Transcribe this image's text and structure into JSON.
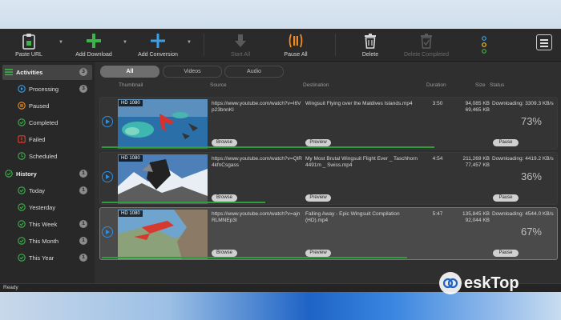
{
  "toolbar": {
    "paste_url": "Paste URL",
    "add_download": "Add Download",
    "add_conversion": "Add Conversion",
    "start_all": "Start All",
    "pause_all": "Pause All",
    "delete": "Delete",
    "delete_completed": "Delete Completed",
    "colors": {
      "green": "#3cb44b",
      "blue": "#3aa0e8",
      "orange": "#f08a24"
    }
  },
  "sidebar": {
    "activities": {
      "label": "Activities",
      "count": "3"
    },
    "processing": {
      "label": "Processing",
      "count": "3"
    },
    "paused": {
      "label": "Paused"
    },
    "completed": {
      "label": "Completed"
    },
    "failed": {
      "label": "Failed"
    },
    "scheduled": {
      "label": "Scheduled"
    },
    "history": {
      "label": "History",
      "count": "1"
    },
    "today": {
      "label": "Today",
      "count": "1"
    },
    "yesterday": {
      "label": "Yesterday"
    },
    "this_week": {
      "label": "This Week",
      "count": "1"
    },
    "this_month": {
      "label": "This Month",
      "count": "1"
    },
    "this_year": {
      "label": "This Year",
      "count": "1"
    }
  },
  "filter_tabs": {
    "all": "All",
    "videos": "Videos",
    "audio": "Audio"
  },
  "columns": {
    "thumbnail": "Thumbnail",
    "source": "Source",
    "destination": "Destination",
    "duration": "Duration",
    "size": "Size",
    "status": "Status"
  },
  "downloads": [
    {
      "badge": "HD 1080",
      "url": "https://www.youtube.com/watch?v=I6Vp23bnnKI",
      "destination": "Wingsuit Flying over the Maldives Islands.mp4",
      "duration": "3:50",
      "size_total": "94,085 KB",
      "size_done": "69,465 KB",
      "status": "Downloading: 3309.3 KB/s",
      "percent": "73%",
      "progress": 0.73,
      "browse": "Browse",
      "preview": "Preview",
      "pause": "Pause"
    },
    {
      "badge": "HD 1080",
      "url": "https://www.youtube.com/watch?v=QlR4kfnCsgass",
      "destination": "My Most Brutal Wingsuit Flight Ever _ Taschhorn 4491m _ Swiss.mp4",
      "duration": "4:54",
      "size_total": "211,269 KB",
      "size_done": "77,457 KB",
      "status": "Downloading: 4419.2 KB/s",
      "percent": "36%",
      "progress": 0.36,
      "browse": "Browse",
      "preview": "Preview",
      "pause": "Pause"
    },
    {
      "badge": "HD 1080",
      "url": "https://www.youtube.com/watch?v=ajnRLMNEp3I",
      "destination": "Falling Away - Epic Wingsuit Compilation (HD).mp4",
      "duration": "5:47",
      "size_total": "135,845 KB",
      "size_done": "92,044 KB",
      "status": "Downloading: 4544.0 KB/s",
      "percent": "67%",
      "progress": 0.67,
      "browse": "Browse",
      "preview": "Preview",
      "pause": "Pause"
    }
  ],
  "statusbar": {
    "text": "Ready"
  },
  "watermark": {
    "text": "eskTop"
  }
}
